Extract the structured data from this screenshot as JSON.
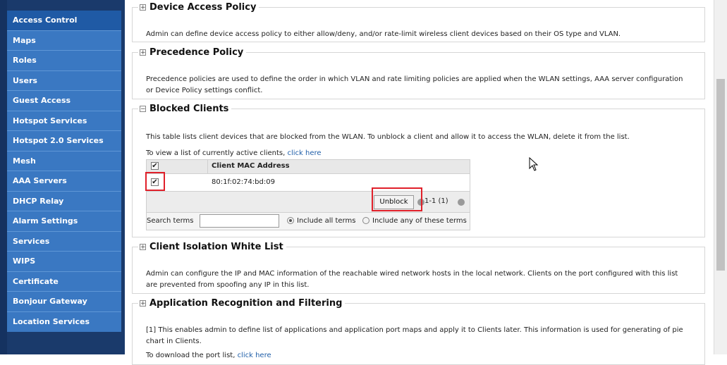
{
  "sidebar": {
    "items": [
      {
        "label": "Access Control",
        "active": true
      },
      {
        "label": "Maps"
      },
      {
        "label": "Roles"
      },
      {
        "label": "Users"
      },
      {
        "label": "Guest Access"
      },
      {
        "label": "Hotspot Services"
      },
      {
        "label": "Hotspot 2.0 Services"
      },
      {
        "label": "Mesh"
      },
      {
        "label": "AAA Servers"
      },
      {
        "label": "DHCP Relay"
      },
      {
        "label": "Alarm Settings"
      },
      {
        "label": "Services"
      },
      {
        "label": "WIPS"
      },
      {
        "label": "Certificate"
      },
      {
        "label": "Bonjour Gateway"
      },
      {
        "label": "Location Services"
      }
    ]
  },
  "sections": {
    "device_access": {
      "title": "Device Access Policy",
      "toggle": "+",
      "desc": "Admin can define device access policy to either allow/deny, and/or rate-limit wireless client devices based on their OS type and VLAN."
    },
    "precedence": {
      "title": "Precedence Policy",
      "toggle": "+",
      "desc1": "Precedence policies are used to define the order in which VLAN and rate limiting policies are applied when the WLAN settings, AAA server configuration",
      "desc2": "or Device Policy settings conflict."
    },
    "blocked": {
      "title": "Blocked Clients",
      "toggle": "−",
      "desc": "This table lists client devices that are blocked from the WLAN. To unblock a client and allow it to access the WLAN, delete it from the list.",
      "view_text": "To view a list of currently active clients, ",
      "view_link": "click here",
      "column_header": "Client MAC Address",
      "rows": [
        {
          "mac": "80:1f:02:74:bd:09",
          "checked": true
        }
      ],
      "unblock_label": "Unblock",
      "pager": "1-1 (1)",
      "search_label": "Search terms",
      "search_value": "",
      "radio_all": "Include all terms",
      "radio_any": "Include any of these terms"
    },
    "isolation": {
      "title": "Client Isolation White List",
      "toggle": "+",
      "desc1": "Admin can configure the IP and MAC information of the reachable wired network hosts in the local network. Clients on the port configured with this list",
      "desc2": "are prevented from spoofing any IP in this list."
    },
    "apprec": {
      "title": "Application Recognition and Filtering",
      "toggle": "+",
      "desc1": "[1] This enables admin to define list of applications and application port maps and apply it to Clients later. This information is used for generating of pie",
      "desc2": "chart in Clients.",
      "download_text": "To download the port list, ",
      "download_link": "click here"
    }
  },
  "colors": {
    "sidebar_bg": "#3a78c2",
    "sidebar_dark": "#1a3a6b",
    "highlight_red": "#e0202a",
    "link": "#1f5ea8"
  }
}
